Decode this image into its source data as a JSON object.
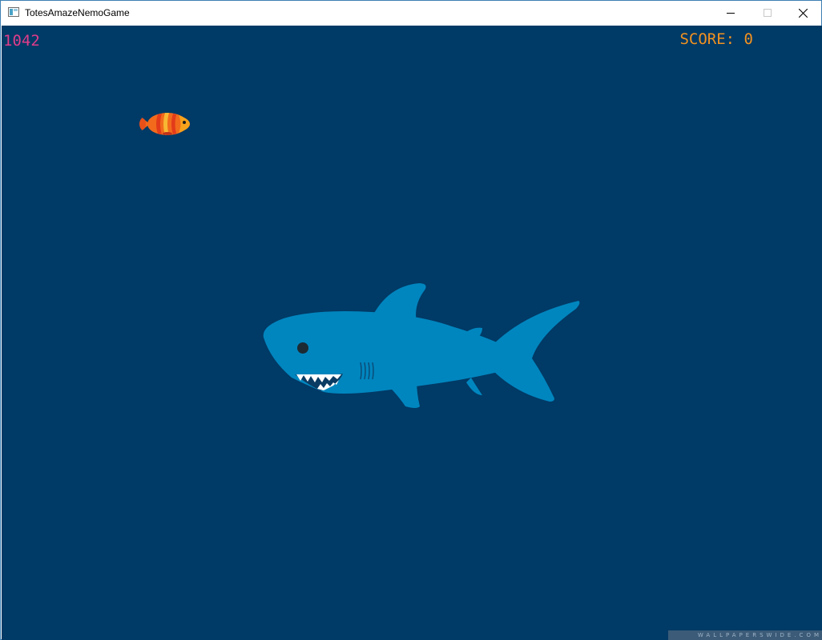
{
  "window": {
    "title": "TotesAmazeNemoGame"
  },
  "titlebar_icons": {
    "app": "app-window-icon",
    "minimize": "minimize-icon",
    "maximize": "maximize-icon",
    "close": "close-icon"
  },
  "hud": {
    "timer": "1042",
    "score_text": "SCORE: 0"
  },
  "sprites": {
    "player": "clownfish",
    "enemy": "shark"
  },
  "watermark": "WALLPAPERSWIDE.COM",
  "colors": {
    "background": "#003a66",
    "timer": "#e03c8a",
    "score": "#f29220",
    "shark_body": "#0086bf",
    "clownfish_body": "#f26a1c"
  }
}
